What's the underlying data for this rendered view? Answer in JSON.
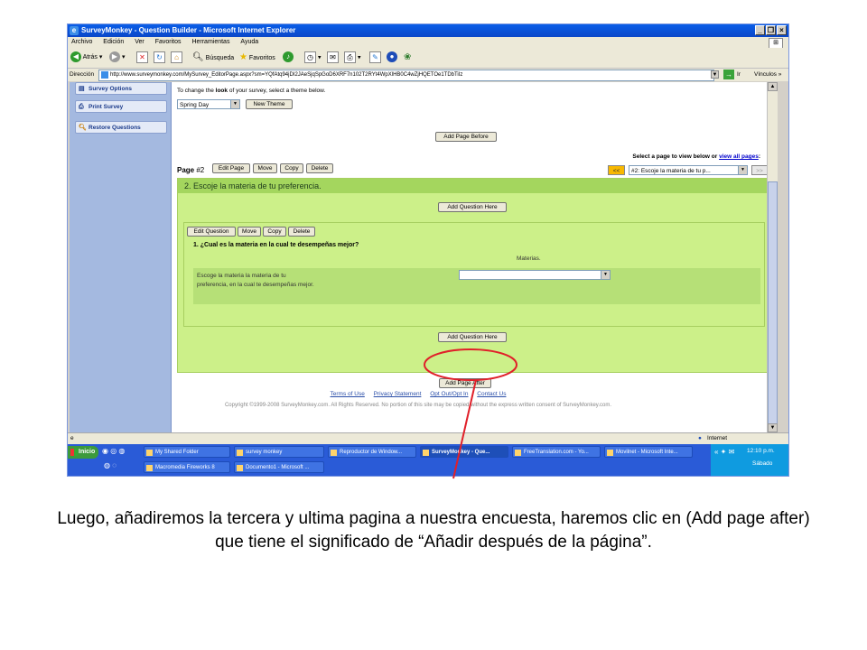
{
  "window": {
    "title": "SurveyMonkey - Question Builder - Microsoft Internet Explorer",
    "controls": [
      "_",
      "❐",
      "×"
    ]
  },
  "menu": [
    "Archivo",
    "Edición",
    "Ver",
    "Favoritos",
    "Herramientas",
    "Ayuda"
  ],
  "toolbar": {
    "back": "Atrás",
    "search": "Búsqueda",
    "favorites": "Favoritos"
  },
  "address": {
    "label": "Dirección",
    "url": "http://www.surveymonkey.com/MySurvey_EditorPage.aspx?sm=YQfAtq94jDI2JAeSjqSpGoD6XRF7n102T2RYt4WpXlHB0C4wZjHQETOe1TDbTiIz",
    "go": "Ir",
    "links": "Vínculos »"
  },
  "sidebar": {
    "items": [
      {
        "label": "Survey Options"
      },
      {
        "label": "Print Survey"
      },
      {
        "label": "Restore Questions"
      }
    ]
  },
  "look": {
    "text_pre": "To change the ",
    "text_bold": "look",
    "text_post": " of your survey, select a theme below.",
    "theme_value": "Spring Day",
    "new_theme": "New Theme"
  },
  "add_page_before": "Add Page Before",
  "page_nav": {
    "text": "Select a page to view below or ",
    "link": "view all pages",
    "colon": ":",
    "prev": "<<",
    "selected": "#2: Escoje la materia de tu p...",
    "next": ">>"
  },
  "page": {
    "label": "Page",
    "number": "#2",
    "buttons": [
      "Edit Page",
      "Move",
      "Copy",
      "Delete"
    ],
    "heading": "2. Escoje la materia de tu preferencia.",
    "add_question_here": "Add Question Here"
  },
  "question": {
    "buttons": [
      "Edit Question",
      "Move",
      "Copy",
      "Delete"
    ],
    "title": "1. ¿Cual es la materia en la cual te desempeñas mejor?",
    "column_header": "Materias.",
    "row_text": "Escoge la materia la materia de tu preferencia, en la cual te desempeñas mejor."
  },
  "add_page_after": "Add Page After",
  "footer": {
    "links": [
      "Terms of Use",
      "Privacy Statement",
      "Opt Out/Opt In",
      "Contact Us"
    ],
    "copyright": "Copyright ©1999-2008 SurveyMonkey.com. All Rights Reserved. No portion of this site may be copied without the express written consent of SurveyMonkey.com."
  },
  "status": {
    "zone": "Internet"
  },
  "taskbar": {
    "start": "Inicio",
    "row1": [
      "My Shared Folder",
      "survey monkey",
      "Reproductor de Window...",
      "SurveyMonkey - Que...",
      "FreeTranslation.com - Yo...",
      "Movilnet - Microsoft Inte..."
    ],
    "row2": [
      "Macromedia Fireworks 8",
      "Documento1 - Microsoft ..."
    ],
    "clock": "12:10 p.m.",
    "day": "Sábado"
  },
  "caption": "Luego, añadiremos la tercera y ultima pagina a nuestra encuesta, haremos clic en (Add page after) que tiene el significado de “Añadir después de la página”.",
  "colors": {
    "annotation": "#e0202a",
    "page_bg": "#ccf089",
    "page_head": "#a4d65e",
    "sidebar": "#a4b9e0"
  }
}
